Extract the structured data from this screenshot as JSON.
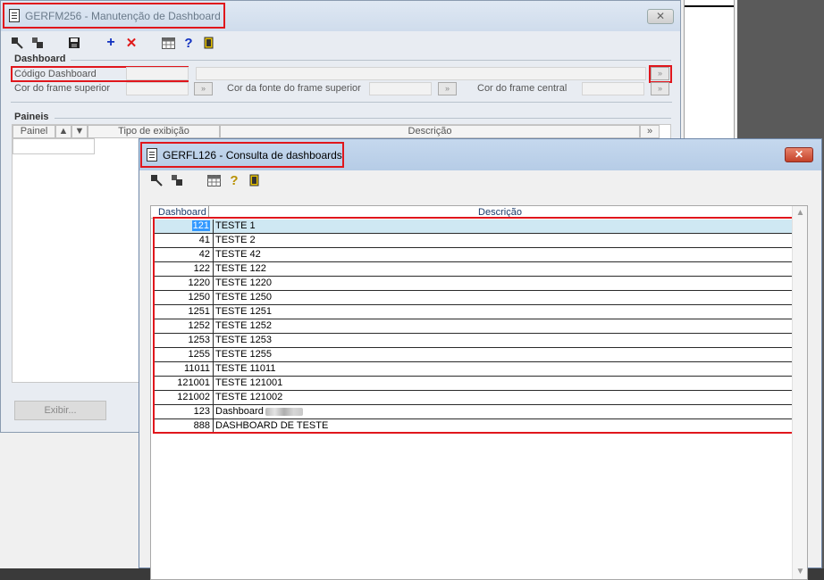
{
  "back_window": {
    "title": "GERFM256 - Manutenção de Dashboard",
    "close": "✕",
    "group_dashboard": "Dashboard",
    "codigo_label": "Código Dashboard",
    "cor_superior_label": "Cor do frame superior",
    "cor_fonte_label": "Cor da fonte do frame superior",
    "cor_central_label": "Cor do frame central",
    "group_paineis": "Paineis",
    "col_painel": "Painel",
    "col_tipo": "Tipo de exibição",
    "col_descricao": "Descrição",
    "exibir_button": "Exibir...",
    "dots": "»"
  },
  "front_window": {
    "title": "GERFL126 - Consulta de dashboards",
    "close": "✕",
    "columns": {
      "dashboard": "Dashboard",
      "descricao": "Descrição"
    },
    "rows": [
      {
        "num": "121",
        "desc": "TESTE 1"
      },
      {
        "num": "41",
        "desc": "TESTE 2"
      },
      {
        "num": "42",
        "desc": "TESTE 42"
      },
      {
        "num": "122",
        "desc": "TESTE 122"
      },
      {
        "num": "1220",
        "desc": "TESTE 1220"
      },
      {
        "num": "1250",
        "desc": "TESTE 1250"
      },
      {
        "num": "1251",
        "desc": "TESTE 1251"
      },
      {
        "num": "1252",
        "desc": "TESTE 1252"
      },
      {
        "num": "1253",
        "desc": "TESTE 1253"
      },
      {
        "num": "1255",
        "desc": "TESTE 1255"
      },
      {
        "num": "11011",
        "desc": "TESTE 11011"
      },
      {
        "num": "121001",
        "desc": "TESTE 121001"
      },
      {
        "num": "121002",
        "desc": "TESTE 121002"
      },
      {
        "num": "123",
        "desc": "Dashboard"
      },
      {
        "num": "888",
        "desc": "DASHBOARD DE TESTE"
      }
    ]
  },
  "icons": {
    "first": "first-record-icon",
    "last": "last-record-icon",
    "save": "save-icon",
    "add": "add-icon",
    "delete": "delete-icon",
    "calendar": "grid-icon",
    "help": "help-icon",
    "exit": "exit-door-icon"
  },
  "colors": {
    "highlight": "#e0161c",
    "selection": "#3399ff"
  }
}
